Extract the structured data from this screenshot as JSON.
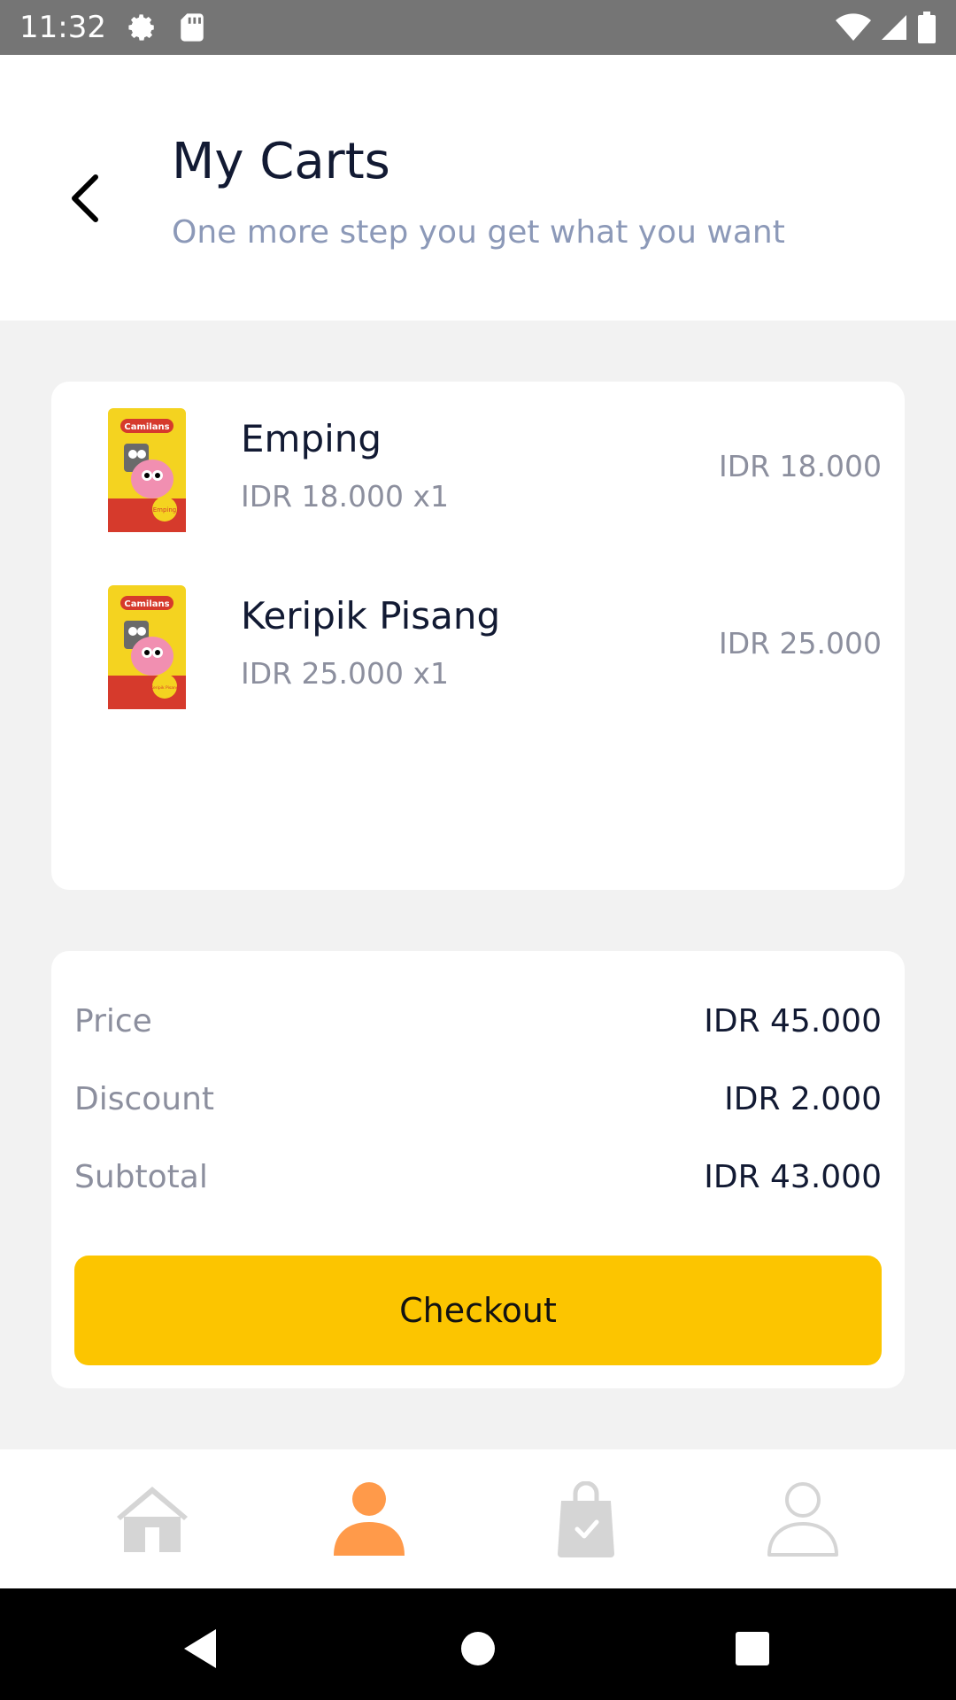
{
  "status_bar": {
    "time": "11:32",
    "icons": [
      "settings-icon",
      "sd-card-icon",
      "wifi-icon",
      "signal-icon",
      "battery-icon"
    ]
  },
  "header": {
    "title": "My Carts",
    "subtitle": "One more step you get what you want"
  },
  "cart": {
    "items": [
      {
        "name": "Emping",
        "unit_line": "IDR 18.000 x1",
        "total": "IDR 18.000",
        "brand": "Camilans",
        "package_label": "Emping"
      },
      {
        "name": "Keripik Pisang",
        "unit_line": "IDR 25.000 x1",
        "total": "IDR 25.000",
        "brand": "Camilans",
        "package_label": "Keripik Pisang"
      }
    ]
  },
  "summary": {
    "price_label": "Price",
    "price_value": "IDR 45.000",
    "discount_label": "Discount",
    "discount_value": "IDR 2.000",
    "subtotal_label": "Subtotal",
    "subtotal_value": "IDR 43.000",
    "checkout_label": "Checkout"
  },
  "bottom_nav": {
    "items": [
      {
        "icon": "home-icon",
        "active": false
      },
      {
        "icon": "person-icon",
        "active": true
      },
      {
        "icon": "shopping-bag-icon",
        "active": false
      },
      {
        "icon": "profile-outline-icon",
        "active": false
      }
    ]
  },
  "colors": {
    "accent": "#fcc500",
    "active_nav": "#ff9a4a",
    "inactive_nav": "#d5d5d5",
    "title": "#121a33",
    "subtitle": "#8c99b8",
    "muted": "#8c8f9e"
  }
}
